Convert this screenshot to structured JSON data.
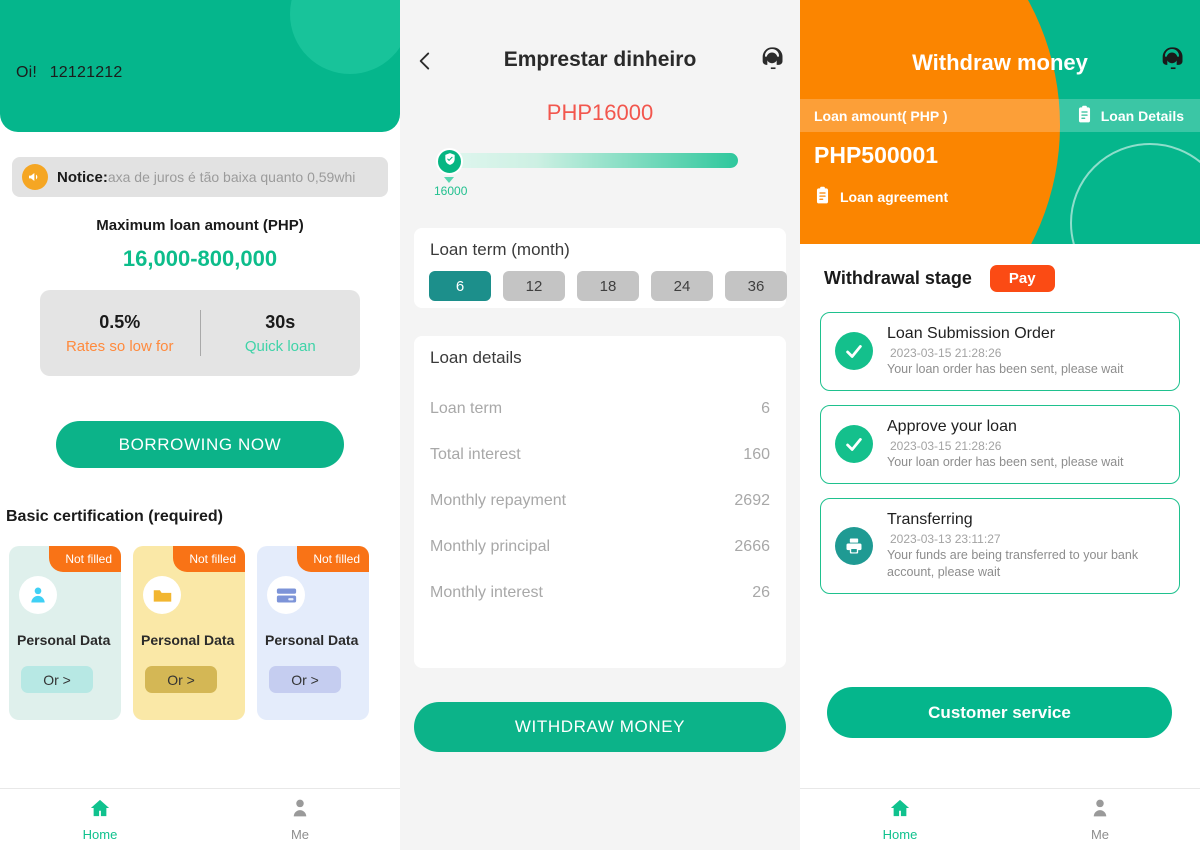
{
  "theme": {
    "green": "#05b68c",
    "green_btn": "#0cb389",
    "orange": "#fb8500",
    "teal": "#1c8f8b",
    "red": "#f2564d",
    "pay_orange": "#fb4b14"
  },
  "home": {
    "greeting": "Oi!",
    "user_id": "12121212",
    "notice_label": "Notice:",
    "notice_text": "axa de juros é tão baixa quanto 0,59whi",
    "notice_icon": "megaphone-icon",
    "max_loan_label": "Maximum loan amount (PHP)",
    "max_loan_amount": "16,000-800,000",
    "stats": [
      {
        "value": "0.5%",
        "caption": "Rates so low for"
      },
      {
        "value": "30s",
        "caption": "Quick loan"
      }
    ],
    "borrow_button": "BORROWING NOW",
    "cert_section_title": "Basic certification (required)",
    "cert_cards": [
      {
        "badge": "Not filled",
        "name": "Personal Data",
        "action": "Or >",
        "icon": "person-icon"
      },
      {
        "badge": "Not filled",
        "name": "Personal Data",
        "action": "Or >",
        "icon": "folder-icon"
      },
      {
        "badge": "Not filled",
        "name": "Personal Data",
        "action": "Or >",
        "icon": "bank-card-icon"
      }
    ]
  },
  "borrow": {
    "back_icon": "chevron-left-icon",
    "title": "Emprestar dinheiro",
    "support_icon": "headset-icon",
    "amount": "PHP16000",
    "slider_value": "16000",
    "slider_icon": "shield-check-icon",
    "loan_term_title": "Loan term (month)",
    "terms": [
      "6",
      "12",
      "18",
      "24",
      "36"
    ],
    "selected_term": "6",
    "loan_details_title": "Loan details",
    "details": [
      {
        "label": "Loan term",
        "value": "6"
      },
      {
        "label": "Total interest",
        "value": "160"
      },
      {
        "label": "Monthly repayment",
        "value": "2692"
      },
      {
        "label": "Monthly principal",
        "value": "2666"
      },
      {
        "label": "Monthly interest",
        "value": "26"
      }
    ],
    "withdraw_button": "WITHDRAW MONEY"
  },
  "withdraw": {
    "title": "Withdraw money",
    "support_icon": "headset-icon",
    "subbar_left": "Loan amount( PHP )",
    "subbar_right": "Loan Details",
    "subbar_right_icon": "clipboard-icon",
    "amount": "PHP500001",
    "agreement": "Loan agreement",
    "agreement_icon": "clipboard-icon",
    "stage_title": "Withdrawal stage",
    "pay_button": "Pay",
    "stages": [
      {
        "name": "Loan Submission Order",
        "time": "2023-03-15 21:28:26",
        "desc": "Your loan order has been sent, please wait",
        "icon": "check-icon",
        "state": "done"
      },
      {
        "name": "Approve your loan",
        "time": "2023-03-15 21:28:26",
        "desc": "Your loan order has been sent, please wait",
        "icon": "check-icon",
        "state": "done"
      },
      {
        "name": "Transferring",
        "time": "2023-03-13 23:11:27",
        "desc": "Your funds are being transferred to your bank account, please wait",
        "icon": "printer-icon",
        "state": "pending"
      }
    ],
    "customer_service_button": "Customer service"
  },
  "bottom_nav": {
    "items": [
      {
        "label": "Home",
        "icon": "home-icon",
        "active": true
      },
      {
        "label": "Me",
        "icon": "person-icon",
        "active": false
      }
    ]
  }
}
